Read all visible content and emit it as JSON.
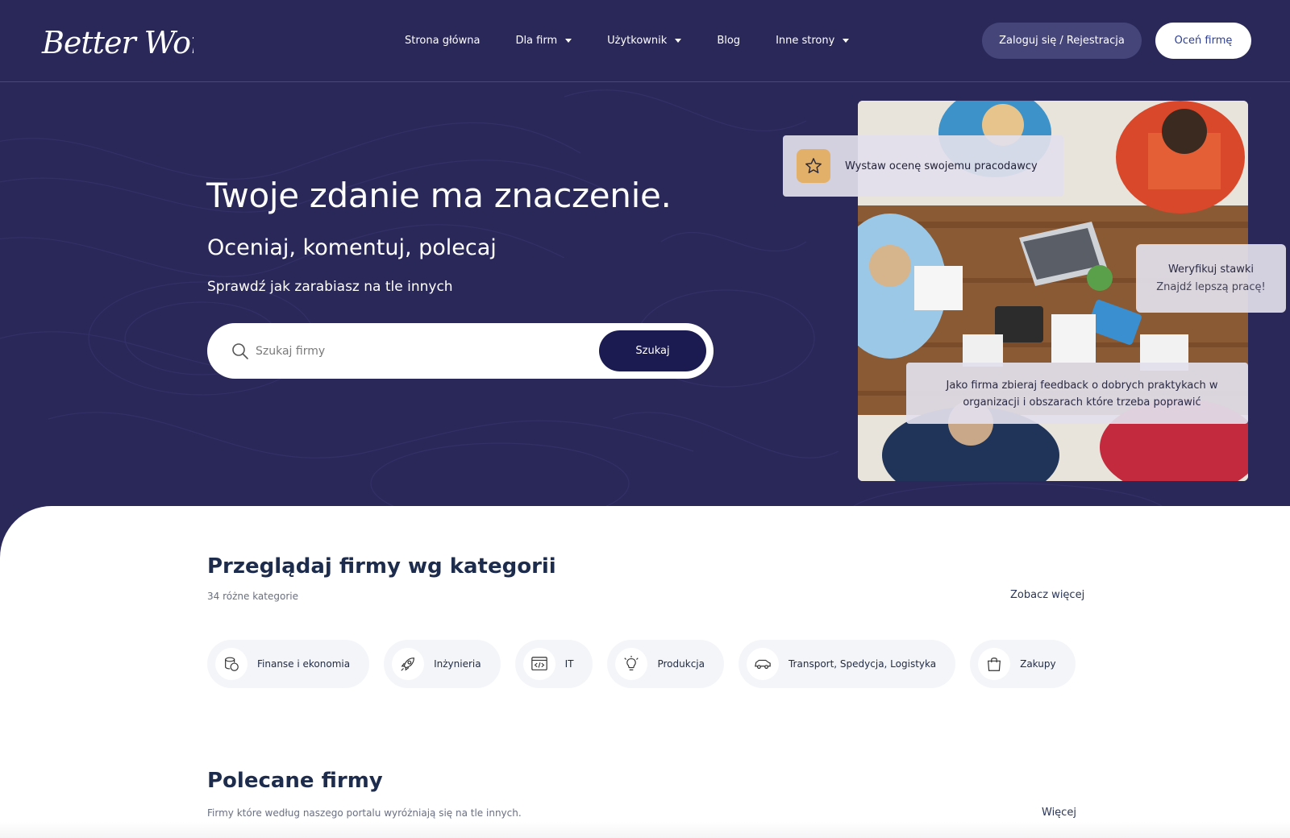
{
  "brand": {
    "logo_text": "Better Work"
  },
  "nav": {
    "items": [
      {
        "label": "Strona główna",
        "dropdown": false
      },
      {
        "label": "Dla firm",
        "dropdown": true
      },
      {
        "label": "Użytkownik",
        "dropdown": true
      },
      {
        "label": "Blog",
        "dropdown": false
      },
      {
        "label": "Inne strony",
        "dropdown": true
      }
    ],
    "login_label": "Zaloguj się / Rejestracja",
    "rate_label": "Oceń firmę"
  },
  "hero": {
    "title": "Twoje zdanie ma znaczenie.",
    "subtitle": "Oceniaj, komentuj, polecaj",
    "tagline": "Sprawdź jak zarabiasz na tle innych",
    "search_placeholder": "Szukaj firmy",
    "search_button": "Szukaj"
  },
  "cards": {
    "rate_text": "Wystaw ocenę swojemu pracodawcy",
    "verify_line1": "Weryfikuj stawki",
    "verify_line2": "Znajdź lepszą pracę!",
    "feedback_text": "Jako firma zbieraj feedback o dobrych praktykach w organizacji i obszarach które trzeba poprawić"
  },
  "categories": {
    "title": "Przeglądaj firmy wg kategorii",
    "subtitle": "34 różne kategorie",
    "more_label": "Zobacz więcej",
    "items": [
      {
        "label": "Finanse i ekonomia",
        "icon": "coins-icon"
      },
      {
        "label": "Inżynieria",
        "icon": "rocket-icon"
      },
      {
        "label": "IT",
        "icon": "code-window-icon"
      },
      {
        "label": "Produkcja",
        "icon": "lightbulb-icon"
      },
      {
        "label": "Transport, Spedycja, Logistyka",
        "icon": "car-icon"
      },
      {
        "label": "Zakupy",
        "icon": "shopping-bag-icon"
      }
    ]
  },
  "featured": {
    "title": "Polecane firmy",
    "subtitle": "Firmy które według naszego portalu wyróżniają się na tle innych.",
    "more_label": "Więcej"
  },
  "colors": {
    "hero_bg": "#2a2859",
    "search_button_bg": "#1b1b52",
    "star_box": "#e3b06a",
    "heading": "#1d2c4c"
  }
}
